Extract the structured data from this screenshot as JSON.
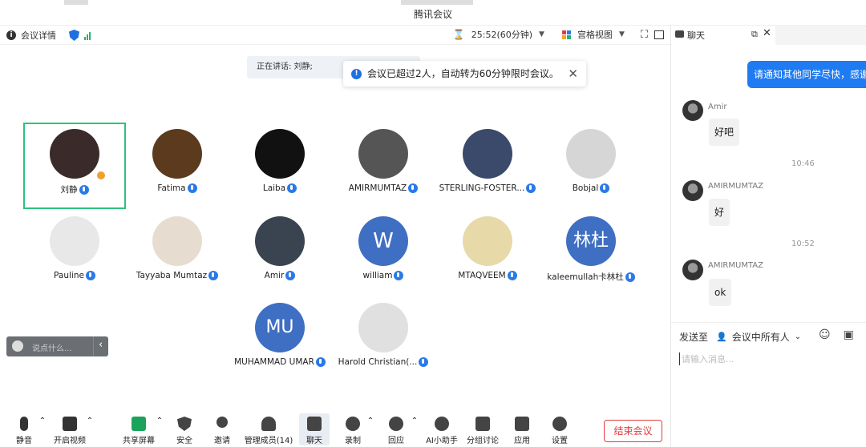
{
  "window": {
    "title": "腾讯会议"
  },
  "infobar": {
    "details_label": "会议详情",
    "timer": "25:52(60分钟)",
    "view_label": "宫格视图"
  },
  "speaking": {
    "text": "正在讲话: 刘静;"
  },
  "notification": {
    "text": "会议已超过2人，自动转为60分钟限时会议。"
  },
  "participants": [
    {
      "name": "刘静",
      "avatar_text": "",
      "color": "#3a2a2a"
    },
    {
      "name": "Fatima",
      "avatar_text": "",
      "color": "#5b3a1d"
    },
    {
      "name": "Laiba",
      "avatar_text": "",
      "color": "#111111"
    },
    {
      "name": "AMIRMUMTAZ",
      "avatar_text": "",
      "color": "#555555"
    },
    {
      "name": "STERLING-FOSTER...",
      "avatar_text": "",
      "color": "#3b4a6a"
    },
    {
      "name": "Bobjal",
      "avatar_text": "",
      "color": "#d6d6d6"
    },
    {
      "name": "Pauline",
      "avatar_text": "",
      "color": "#e8e8e8"
    },
    {
      "name": "Tayyaba  Mumtaz",
      "avatar_text": "",
      "color": "#e6ddd0"
    },
    {
      "name": "Amir",
      "avatar_text": "",
      "color": "#3a4450"
    },
    {
      "name": "william",
      "avatar_text": "W",
      "color": "#3f6fc2"
    },
    {
      "name": "MTAQVEEM",
      "avatar_text": "",
      "color": "#e8d9a8"
    },
    {
      "name": "kaleemullah卡林杜",
      "avatar_text": "林杜",
      "color": "#3f6fc2"
    },
    {
      "name": "MUHAMMAD UMAR",
      "avatar_text": "MU",
      "color": "#3f6fc2"
    },
    {
      "name": "Harold Christian(...",
      "avatar_text": "",
      "color": "#e0e0e0"
    }
  ],
  "reaction": {
    "placeholder": "说点什么..."
  },
  "toolbar": {
    "mute": "静音",
    "video": "开启视频",
    "share": "共享屏幕",
    "security": "安全",
    "invite": "邀请",
    "members": "管理成员(14)",
    "chat": "聊天",
    "record": "录制",
    "reaction": "回应",
    "ai": "AI小助手",
    "breakout": "分组讨论",
    "apps": "应用",
    "settings": "设置",
    "end": "结束会议"
  },
  "chat": {
    "title": "聊天",
    "mine": "请通知其他同学尽快，感谢",
    "messages": [
      {
        "name": "Amir",
        "text": "好吧"
      },
      {
        "name": "AMIRMUMTAZ",
        "text": "好"
      },
      {
        "name": "AMIRMUMTAZ",
        "text": "ok"
      }
    ],
    "times": [
      "10:46",
      "10:52"
    ],
    "send_to_label": "发送至",
    "send_target": "会议中所有人",
    "input_placeholder": "请输入消息..."
  },
  "colors": {
    "accent": "#1f7bf2",
    "active_border": "#2ec27e",
    "end_red": "#e23b3b"
  }
}
